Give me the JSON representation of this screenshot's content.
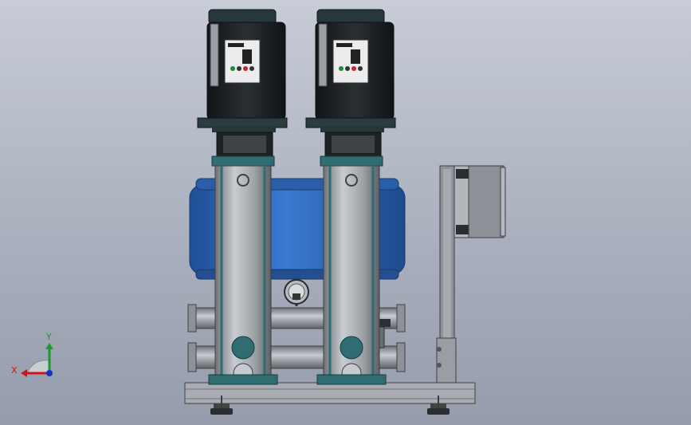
{
  "viewport": {
    "background_top": "#c7ccd6",
    "background_bottom": "#959cab"
  },
  "assembly": {
    "pump_count": 2,
    "motor_color": "#1e2326",
    "motor_cap_color": "#26393c",
    "pump_body_color": "#9aa0a6",
    "accent_teal": "#2f6d73",
    "tank_color": "#2c63b4",
    "frame_color": "#a8acb2",
    "control_box_color": "#8d9096"
  },
  "triad": {
    "x_label": "X",
    "y_label": "Y",
    "x_color": "#d0131a",
    "y_color": "#1a9a2a",
    "z_color": "#1532c8"
  }
}
